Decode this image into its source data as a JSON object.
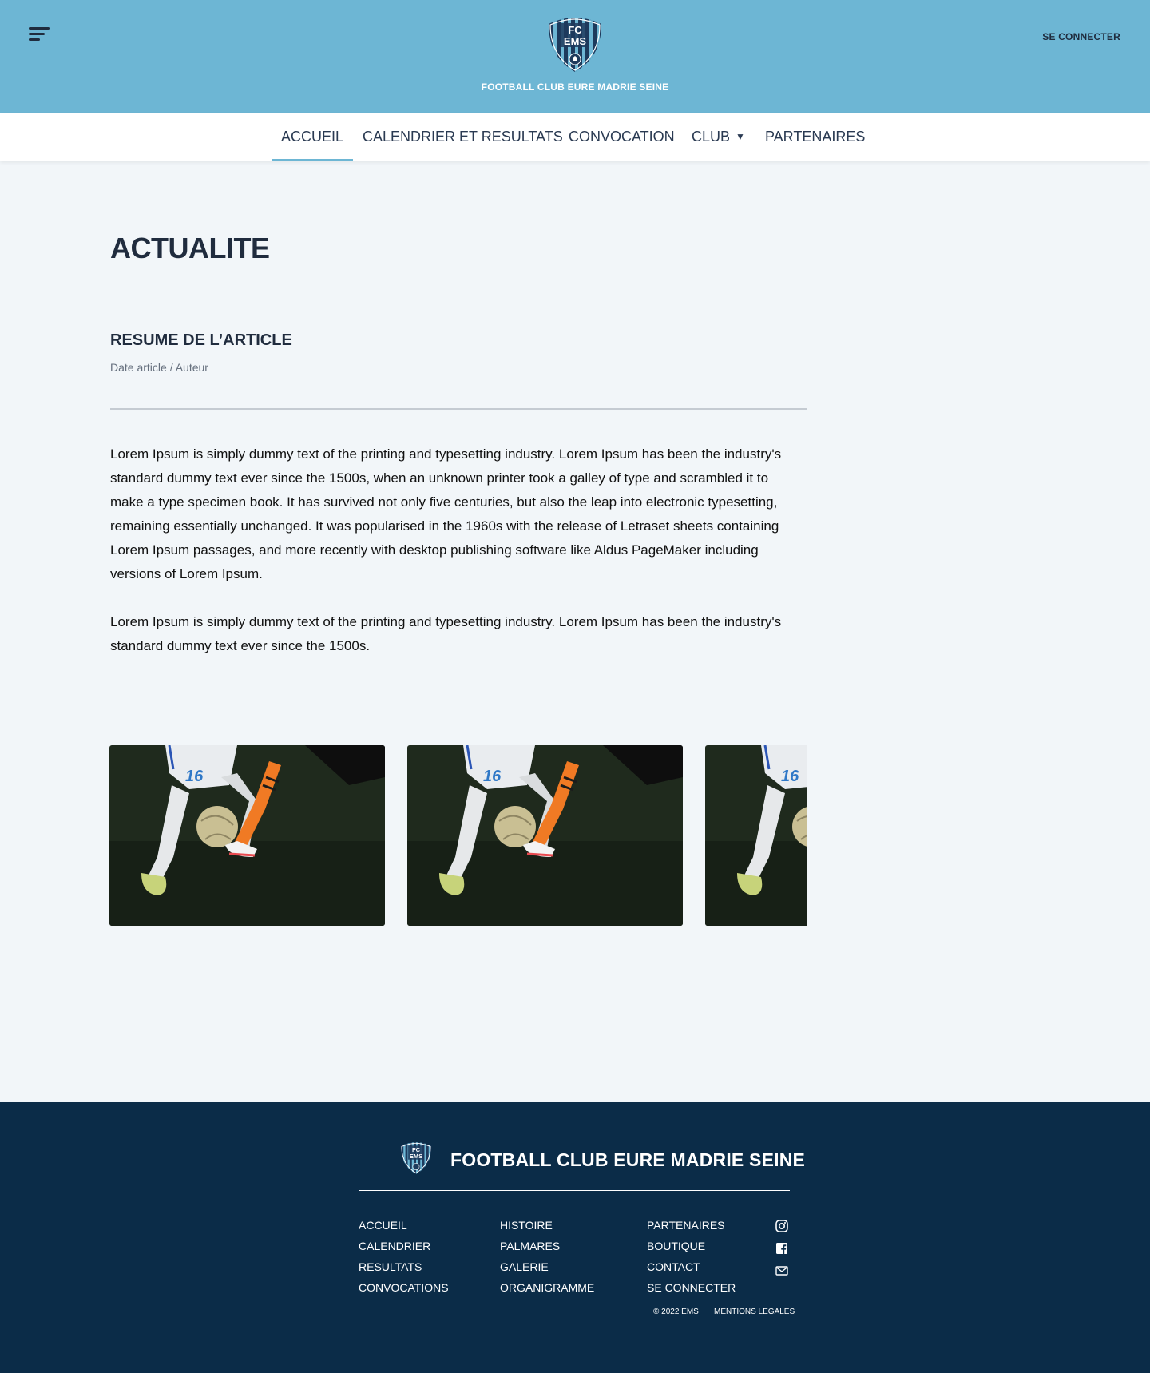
{
  "header": {
    "club_name": "FOOTBALL CLUB EURE MADRIE SEINE",
    "logo_text_line1": "FC",
    "logo_text_line2": "EMS",
    "login_label": "SE CONNECTER",
    "menu_icon": "hamburger-icon"
  },
  "nav": {
    "items": [
      {
        "label": "ACCUEIL",
        "active": true
      },
      {
        "label": "CALENDRIER ET RESULTATS"
      },
      {
        "label": "CONVOCATION"
      },
      {
        "label": "CLUB",
        "has_dropdown": true
      },
      {
        "label": "PARTENAIRES"
      }
    ],
    "dropdown_caret": "▼"
  },
  "main": {
    "page_title": "ACTUALITE",
    "article_summary": "RESUME DE L’ARTICLE",
    "article_meta": "Date article / Auteur",
    "paragraphs": [
      "Lorem Ipsum is simply dummy text of the printing and typesetting industry. Lorem Ipsum has been the industry's standard dummy text ever since the 1500s, when an unknown printer took a galley of type and scrambled it to make a type specimen book. It has survived not only five centuries, but also the leap into electronic typesetting, remaining essentially unchanged. It was popularised in the 1960s with the release of Letraset sheets containing Lorem Ipsum passages, and more recently with desktop publishing software like Aldus PageMaker including versions of Lorem Ipsum.",
      "Lorem Ipsum is simply dummy text of the printing and typesetting industry. Lorem Ipsum has been the industry's standard dummy text ever since the 1500s."
    ],
    "gallery_jersey_number": "16"
  },
  "footer": {
    "club_name": "FOOTBALL CLUB EURE MADRIE SEINE",
    "columns": [
      [
        "ACCUEIL",
        "CALENDRIER",
        "RESULTATS",
        "CONVOCATIONS"
      ],
      [
        "HISTOIRE",
        "PALMARES",
        "GALERIE",
        "ORGANIGRAMME"
      ],
      [
        "PARTENAIRES",
        "BOUTIQUE",
        "CONTACT",
        "SE CONNECTER"
      ]
    ],
    "social_icons": [
      "instagram-icon",
      "facebook-icon",
      "mail-icon"
    ],
    "copyright": "© 2022 EMS",
    "legal": "MENTIONS LEGALES"
  },
  "colors": {
    "header_bg": "#6db6d4",
    "nav_bg": "#ffffff",
    "page_bg": "#f2f6f9",
    "footer_bg": "#0b2c48",
    "accent": "#6db6d4",
    "text_dark": "#202c3e"
  }
}
